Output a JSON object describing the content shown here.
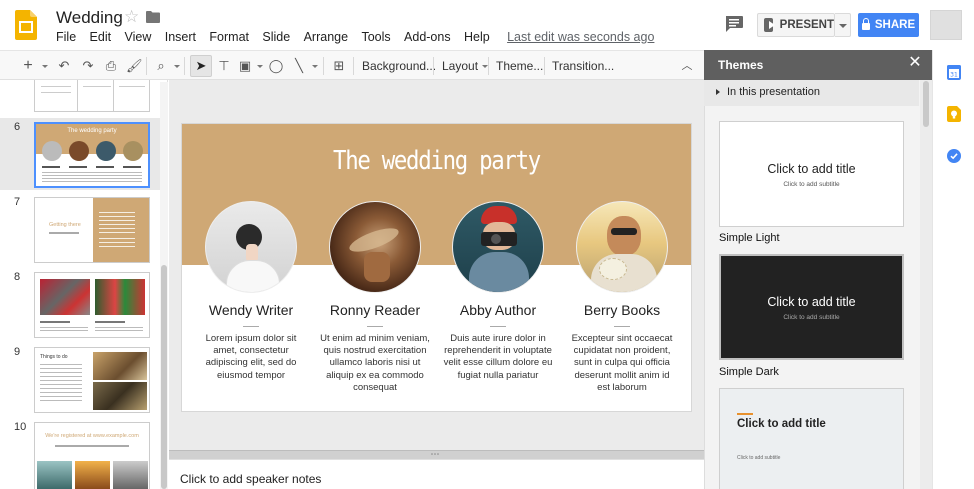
{
  "app": {
    "doc_title": "Wedding",
    "menu": [
      "File",
      "Edit",
      "View",
      "Insert",
      "Format",
      "Slide",
      "Arrange",
      "Tools",
      "Add-ons",
      "Help"
    ],
    "last_edit": "Last edit was seconds ago",
    "present_label": "PRESENT",
    "share_label": "SHARE"
  },
  "toolbar": {
    "background_label": "Background...",
    "layout_label": "Layout",
    "theme_label": "Theme...",
    "transition_label": "Transition..."
  },
  "filmstrip": {
    "slides": [
      {
        "number": "6",
        "title": "The wedding party",
        "selected": true
      },
      {
        "number": "7",
        "title": "Getting there"
      },
      {
        "number": "8",
        "title": ""
      },
      {
        "number": "9",
        "title": "Things to do"
      },
      {
        "number": "10",
        "title": "We're registered at www.example.com"
      }
    ]
  },
  "slide": {
    "title": "The wedding party",
    "people": [
      {
        "name": "Wendy Writer",
        "desc": "Lorem ipsum dolor sit amet, consectetur adipiscing elit, sed do eiusmod tempor"
      },
      {
        "name": "Ronny Reader",
        "desc": "Ut enim ad minim veniam, quis nostrud exercitation ullamco laboris nisi ut aliquip ex ea commodo consequat"
      },
      {
        "name": "Abby Author",
        "desc": "Duis aute irure dolor in reprehenderit in voluptate velit esse cillum dolore eu fugiat nulla pariatur"
      },
      {
        "name": "Berry Books",
        "desc": "Excepteur sint occaecat cupidatat non proident, sunt in culpa qui officia deserunt mollit anim id est laborum"
      }
    ],
    "accent_color": "#cfa875"
  },
  "notes": {
    "placeholder": "Click to add speaker notes"
  },
  "themes": {
    "panel_title": "Themes",
    "section_label": "In this presentation",
    "items": [
      {
        "name": "Simple Light",
        "title": "Click to add title",
        "subtitle": "Click to add subtitle"
      },
      {
        "name": "Simple Dark",
        "title": "Click to add title",
        "subtitle": "Click to add subtitle"
      },
      {
        "name": "",
        "title": "Click to add title",
        "subtitle": "Click to add subtitle"
      }
    ]
  }
}
